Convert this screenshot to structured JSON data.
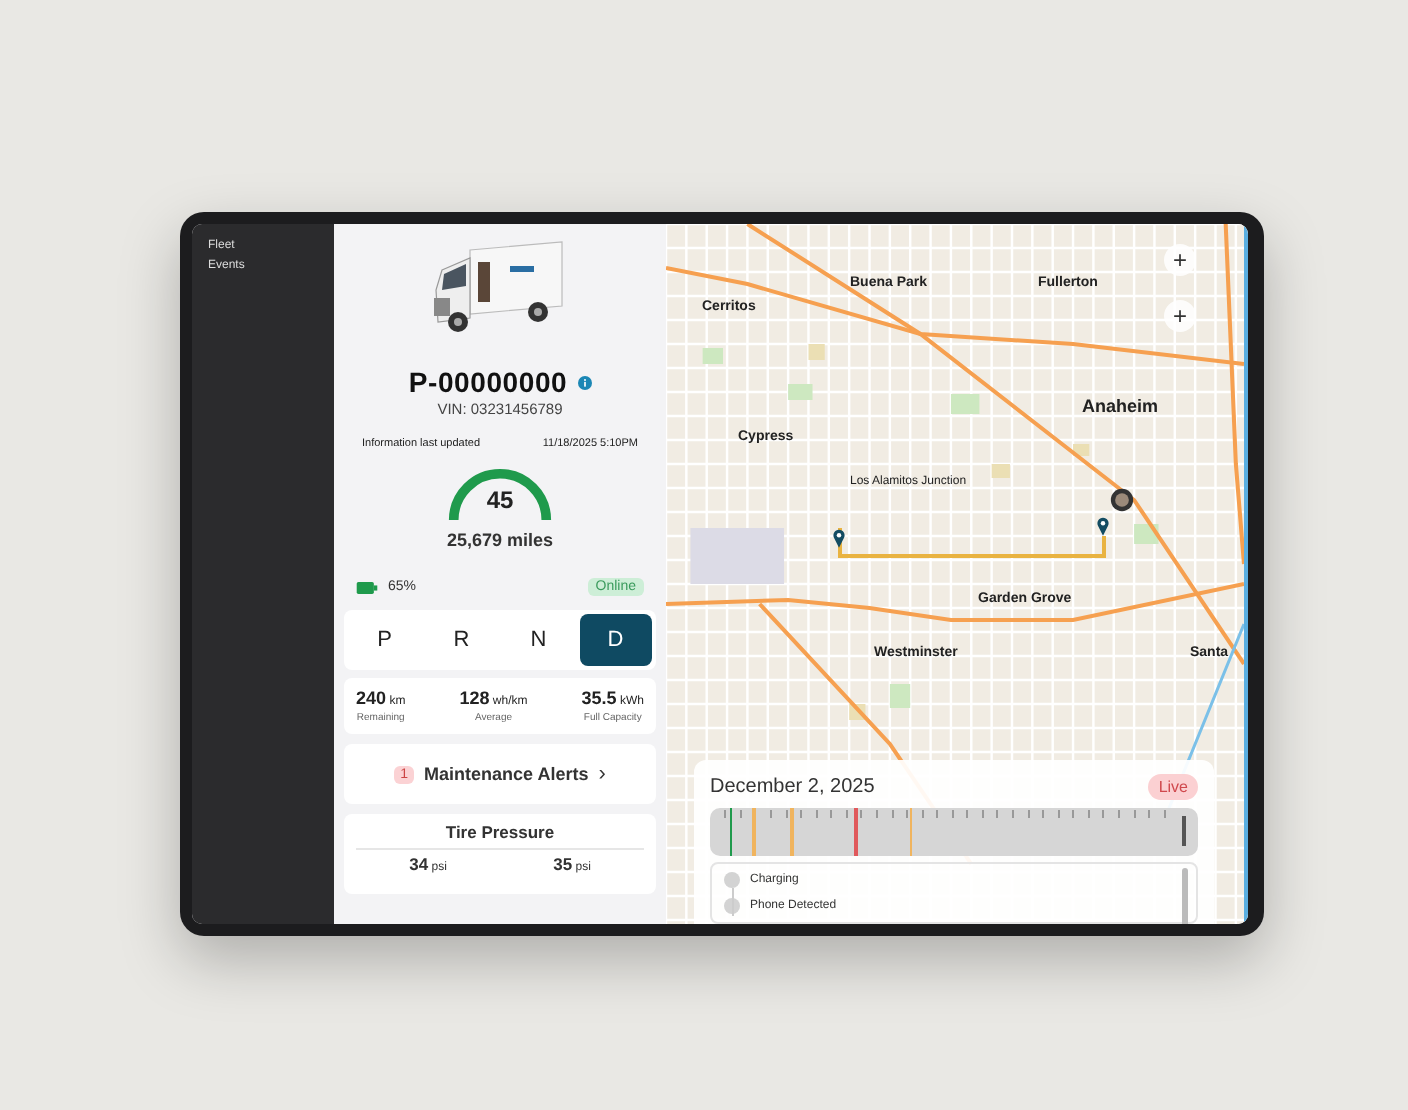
{
  "sidebar": {
    "items": [
      {
        "label": "Fleet",
        "selected": false
      },
      {
        "label": "Events",
        "selected": false
      }
    ]
  },
  "vehicle": {
    "id": "P-00000000",
    "vin": "VIN: 03231456789",
    "updated_label": "Information last updated",
    "updated_value": "11/18/2025 5:10PM",
    "gauge_reading": "45",
    "odometer": "25,679 miles",
    "battery_reading": "65%",
    "status": "Online"
  },
  "gears": [
    {
      "label": "P",
      "selected": false
    },
    {
      "label": "R",
      "selected": false
    },
    {
      "label": "N",
      "selected": false
    },
    {
      "label": "D",
      "selected": true
    }
  ],
  "stats": [
    {
      "value": "240",
      "unit": "km",
      "label": "Remaining"
    },
    {
      "value": "128",
      "unit": "wh/km",
      "label": "Average"
    },
    {
      "value": "35.5",
      "unit": "kWh",
      "label": "Full Capacity"
    }
  ],
  "alerts": {
    "count": "1",
    "label": "Maintenance Alerts",
    "chevron": "›"
  },
  "tires": {
    "title": "Tire Pressure",
    "readings": [
      {
        "value": "34",
        "unit": "psi"
      },
      {
        "value": "35",
        "unit": "psi"
      }
    ]
  },
  "map": {
    "zoom_buttons": [
      "+",
      "+"
    ],
    "labels": [
      "Buena Park",
      "Fullerton",
      "Cerritos",
      "Anaheim",
      "Cypress",
      "Los Alamitos Junction",
      "Garden Grove",
      "Westminster",
      "Santa"
    ]
  },
  "timeline": {
    "date": "December 2, 2025",
    "live": "Live",
    "markers": [
      {
        "color": "#1f9a4c"
      },
      {
        "color": "#f0b45e"
      },
      {
        "color": "#f0b45e"
      },
      {
        "color": "#e0595c"
      },
      {
        "color": "#f0b45e"
      }
    ],
    "events": [
      {
        "label": "Charging"
      },
      {
        "label": "Phone Detected"
      }
    ]
  }
}
